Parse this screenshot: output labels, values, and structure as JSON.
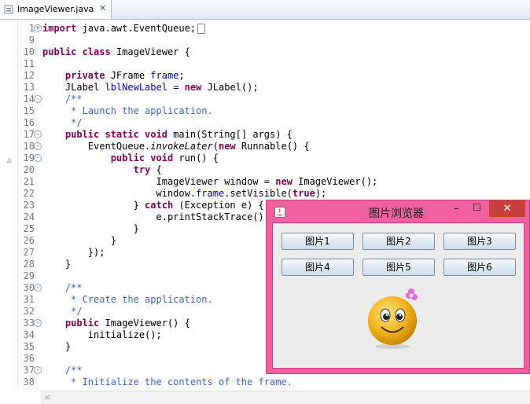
{
  "editor": {
    "tab_label": "ImageViewer.java",
    "tab_close": "✕",
    "lines": [
      {
        "n": "1",
        "fold": "+",
        "html": "<span class='kw'>import</span> java.awt.EventQueue;<span class='sq'></span>"
      },
      {
        "n": "9",
        "html": ""
      },
      {
        "n": "10",
        "html": "<span class='kw'>public class</span> ImageViewer {"
      },
      {
        "n": "11",
        "html": ""
      },
      {
        "n": "12",
        "html": "    <span class='kw'>private</span> JFrame <span class='fld'>frame</span>;"
      },
      {
        "n": "13",
        "html": "    JLabel <span class='fld'>lblNewLabel</span> = <span class='kw'>new</span> JLabel();"
      },
      {
        "n": "14",
        "fold": "-",
        "html": "    <span class='cm'>/**</span>"
      },
      {
        "n": "15",
        "html": "     <span class='cm'>* Launch the application.</span>"
      },
      {
        "n": "16",
        "html": "     <span class='cm'>*/</span>"
      },
      {
        "n": "17",
        "fold": "-",
        "html": "    <span class='kw'>public static void</span> main(String[] args) {"
      },
      {
        "n": "18",
        "fold": "-",
        "html": "        EventQueue.<span class='it'>invokeLater</span>(<span class='kw'>new</span> Runnable() {"
      },
      {
        "n": "19",
        "fold": "-",
        "html": "            <span class='kw'>public void</span> run() {"
      },
      {
        "n": "20",
        "html": "                <span class='kw'>try</span> {"
      },
      {
        "n": "21",
        "html": "                    ImageViewer window = <span class='kw'>new</span> ImageViewer();"
      },
      {
        "n": "22",
        "html": "                    window.<span class='fld'>frame</span>.setVisible(<span class='kw'>true</span>);"
      },
      {
        "n": "23",
        "html": "                } <span class='kw'>catch</span> (Exception e) {"
      },
      {
        "n": "24",
        "html": "                    e.printStackTrace();"
      },
      {
        "n": "25",
        "html": "                }"
      },
      {
        "n": "26",
        "html": "            }"
      },
      {
        "n": "27",
        "html": "        });"
      },
      {
        "n": "28",
        "html": "    }"
      },
      {
        "n": "29",
        "html": ""
      },
      {
        "n": "30",
        "fold": "-",
        "html": "    <span class='cm'>/**</span>"
      },
      {
        "n": "31",
        "html": "     <span class='cm'>* Create the application.</span>"
      },
      {
        "n": "32",
        "html": "     <span class='cm'>*/</span>"
      },
      {
        "n": "33",
        "fold": "-",
        "html": "    <span class='kw'>public</span> ImageViewer() {"
      },
      {
        "n": "34",
        "html": "        initialize();"
      },
      {
        "n": "35",
        "html": "    }"
      },
      {
        "n": "36",
        "html": ""
      },
      {
        "n": "37",
        "fold": "-",
        "html": "    <span class='cm'>/**</span>"
      },
      {
        "n": "38",
        "html": "     <span class='cm'>* Initialize the contents of the frame.</span>"
      }
    ]
  },
  "window": {
    "title": "图片浏览器",
    "min_glyph": "–",
    "max_glyph": "☐",
    "close_glyph": "✕",
    "buttons": [
      "图片1",
      "图片2",
      "图片3",
      "图片4",
      "图片5",
      "图片6"
    ],
    "accent": "#f2609f"
  },
  "colors": {
    "keyword": "#7f0055",
    "comment": "#3f5fbf",
    "field": "#0000c0",
    "linenum": "#787878"
  }
}
